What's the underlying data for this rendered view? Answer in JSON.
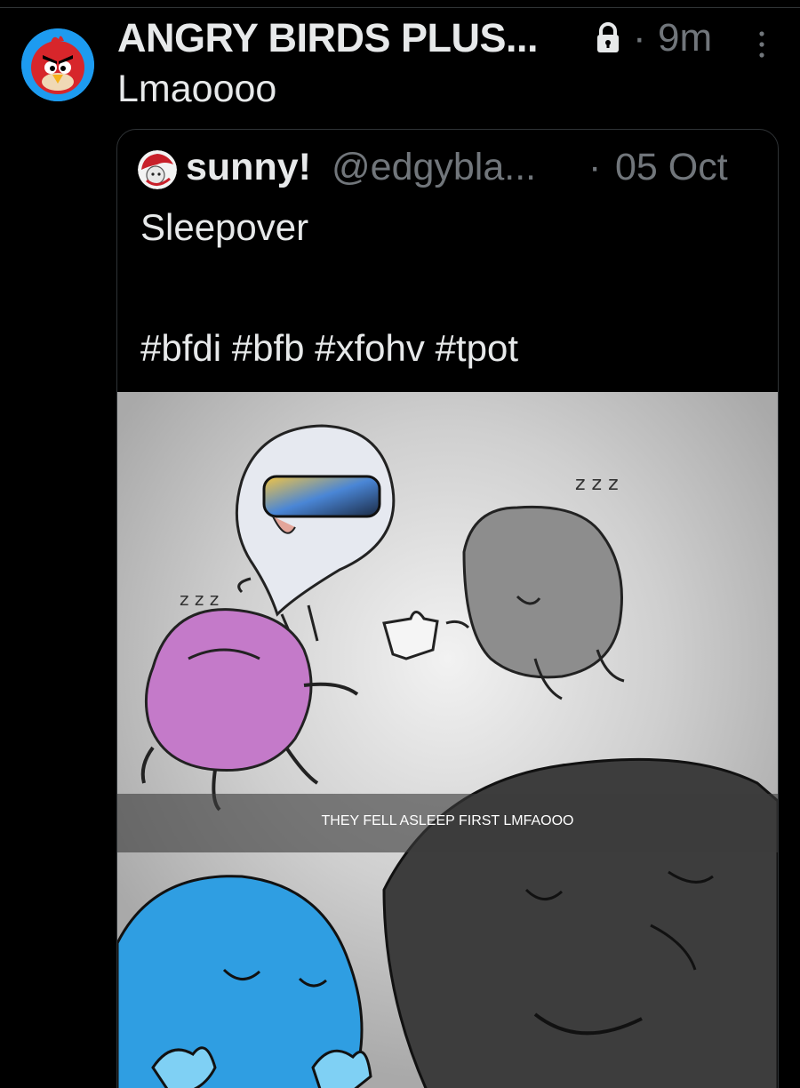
{
  "tweet": {
    "author_name": "ANGRY BIRDS PLUS...",
    "dot": "·",
    "time": "9m",
    "text": "Lmaoooo"
  },
  "quoted_tweet": {
    "name": "sunny!",
    "handle": "@edgybla...",
    "dot": "·",
    "date": "05 Oct",
    "text": "Sleepover",
    "hashtags": "#bfdi #bfb #xfohv #tpot",
    "image_caption": "THEY FELL ASLEEP FIRST LMFAOOO"
  },
  "colors": {
    "background": "#000000",
    "primary_text": "#e7e9ea",
    "secondary_text": "#71767b",
    "border": "#2f3336"
  },
  "icons": {
    "avatar": "angry-bird-avatar",
    "lock": "lock-icon",
    "more": "more-options-icon",
    "quote_avatar": "sunny-avatar"
  }
}
